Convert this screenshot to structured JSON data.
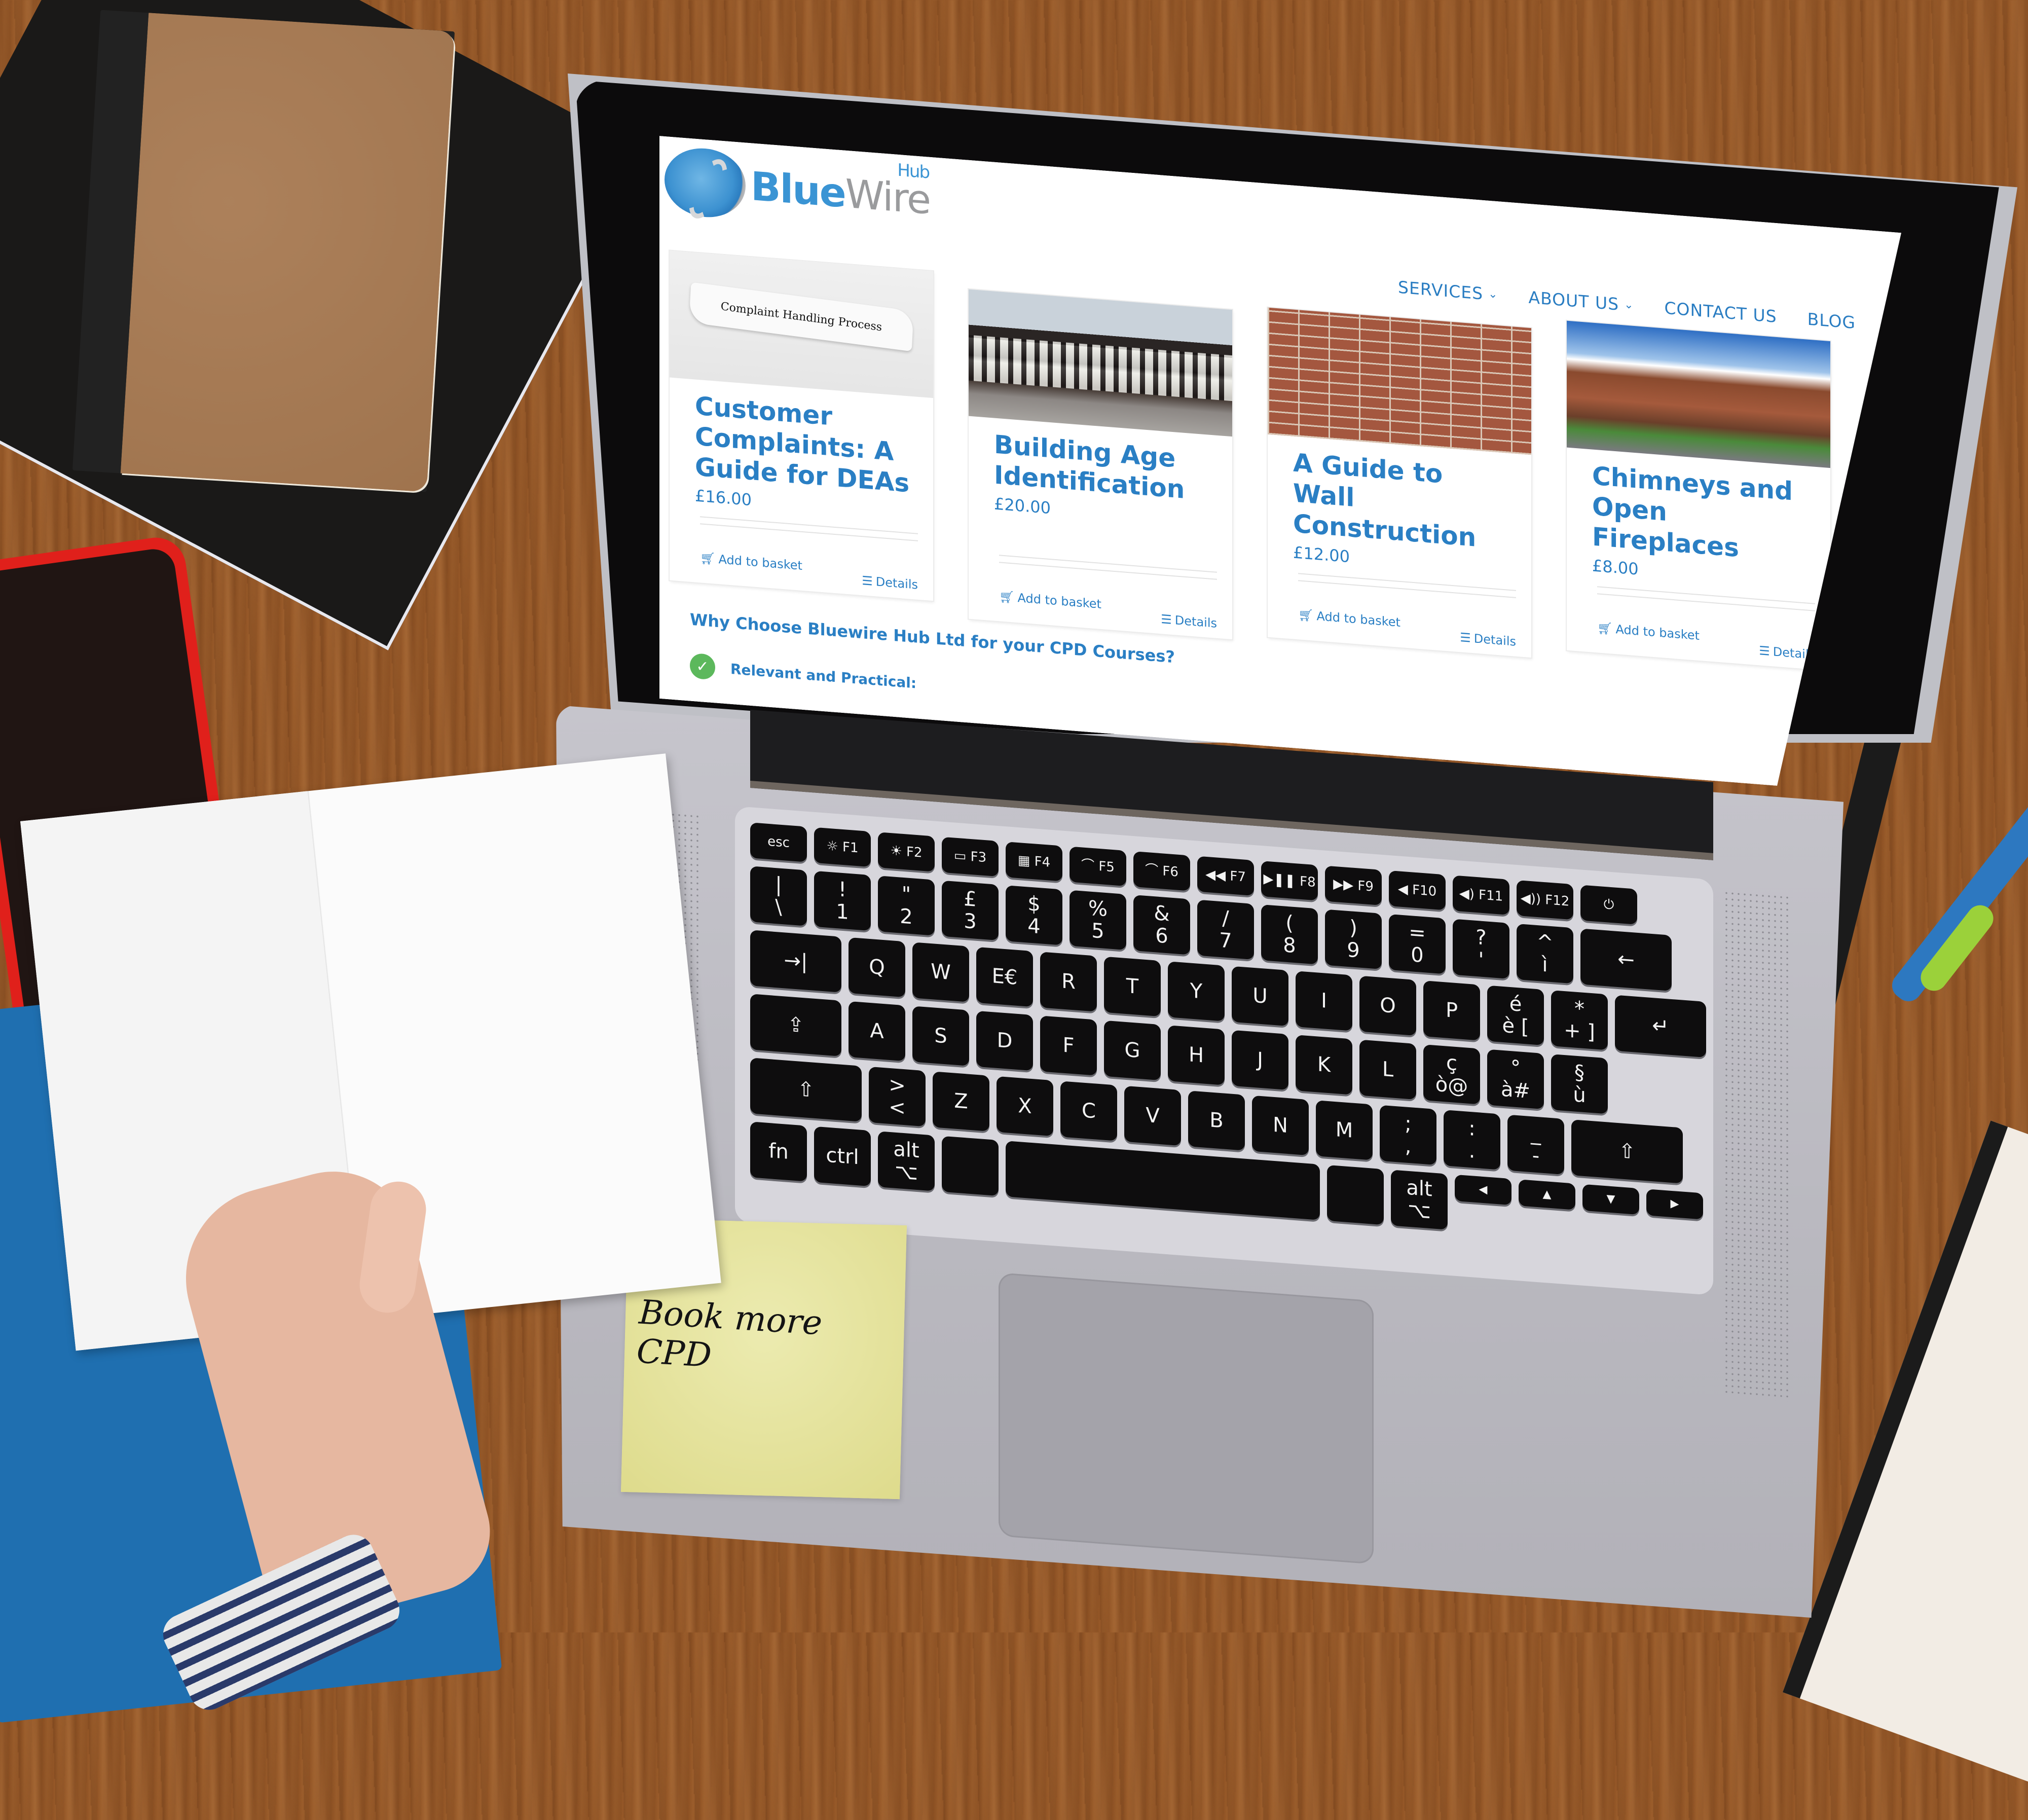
{
  "scene": {
    "description": "Laptop on wooden desk displaying BlueWire Hub website",
    "sticky_note": "Book more CPD"
  },
  "site": {
    "logo": {
      "primary": "Blue",
      "secondary": "Wire",
      "super": "Hub"
    },
    "nav": [
      {
        "label": "SERVICES",
        "has_dropdown": true
      },
      {
        "label": "ABOUT US",
        "has_dropdown": true
      },
      {
        "label": "CONTACT US",
        "has_dropdown": false
      },
      {
        "label": "BLOG",
        "has_dropdown": false
      }
    ],
    "products": [
      {
        "title": "Customer Complaints: A Guide for DEAs",
        "price": "£16.00",
        "image_caption": "Complaint Handling Process",
        "image": "torn-paper"
      },
      {
        "title": "Building Age Identification",
        "price": "£20.00",
        "image_caption": "",
        "image": "tudor-building"
      },
      {
        "title": "A Guide to Wall Construction",
        "price": "£12.00",
        "image_caption": "",
        "image": "brick-wall"
      },
      {
        "title": "Chimneys and Open Fireplaces",
        "price": "£8.00",
        "image_caption": "",
        "image": "terraced-houses"
      }
    ],
    "product_actions": {
      "add_to_basket": "Add to basket",
      "details": "Details"
    },
    "why_heading": "Why Choose Bluewire Hub Ltd for your CPD Courses?",
    "features": [
      {
        "label": "Relevant and Practical:"
      }
    ],
    "colors": {
      "accent": "#2a7fc4",
      "check": "#5cb85c"
    }
  },
  "keyboard": {
    "fn_row": [
      "esc",
      "☼ F1",
      "☀ F2",
      "▭ F3",
      "▦ F4",
      "⌒ F5",
      "⌒ F6",
      "◀◀ F7",
      "▶❚❚ F8",
      "▶▶ F9",
      "◀ F10",
      "◀) F11",
      "◀)) F12",
      "⏻"
    ],
    "row1": [
      "|\n\\",
      "!\n1",
      "\"\n2",
      "£\n3",
      "$\n4",
      "%\n5",
      "&\n6",
      "/\n7",
      "(\n8",
      ")\n9",
      "=\n0",
      "?\n'",
      "^\nì",
      "←"
    ],
    "row2": [
      "→|",
      "Q",
      "W",
      "E€",
      "R",
      "T",
      "Y",
      "U",
      "I",
      "O",
      "P",
      "é\nè [",
      "*\n+ ]",
      "↵"
    ],
    "row3": [
      "⇪",
      "A",
      "S",
      "D",
      "F",
      "G",
      "H",
      "J",
      "K",
      "L",
      "ç\nò@",
      "°\nà#",
      "§\nù"
    ],
    "row4": [
      "⇧",
      ">\n<",
      "Z",
      "X",
      "C",
      "V",
      "B",
      "N",
      "M",
      ";\n,",
      ":\n.",
      "_\n-",
      "⇧"
    ],
    "row5": [
      "fn",
      "ctrl",
      "alt\n⌥",
      "",
      "",
      "",
      "alt\n⌥",
      "◀",
      "▲",
      "▼",
      "▶"
    ]
  }
}
